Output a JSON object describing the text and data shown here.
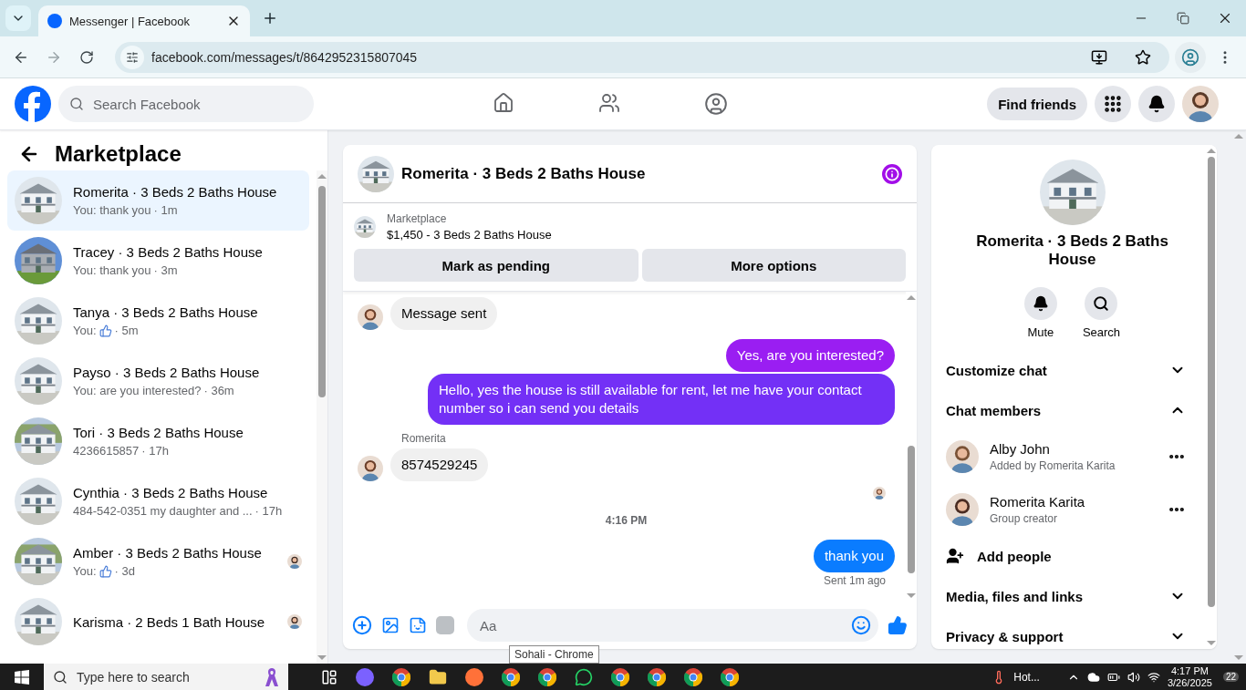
{
  "browser": {
    "tab_title": "Messenger | Facebook",
    "url": "facebook.com/messages/t/8642952315807045"
  },
  "header": {
    "search": {
      "placeholder": "Search Facebook"
    },
    "find_friends": "Find friends"
  },
  "sidebar": {
    "title": "Marketplace",
    "conversations": [
      {
        "name": "Romerita · 3 Beds 2 Baths House",
        "preview": "You: thank you",
        "like": false,
        "time": "· 1m",
        "seen": false,
        "selected": true
      },
      {
        "name": "Tracey · 3 Beds 2 Baths House",
        "preview": "You: thank you",
        "like": false,
        "time": "· 3m",
        "seen": false,
        "selected": false
      },
      {
        "name": "Tanya · 3 Beds 2 Baths House",
        "preview": "You:",
        "like": true,
        "time": "· 5m",
        "seen": false,
        "selected": false
      },
      {
        "name": "Payso · 3 Beds 2 Baths House",
        "preview": "You: are you interested?",
        "like": false,
        "time": "· 36m",
        "seen": false,
        "selected": false
      },
      {
        "name": "Tori · 3 Beds 2 Baths House",
        "preview": "4236615857",
        "like": false,
        "time": "· 17h",
        "seen": false,
        "selected": false
      },
      {
        "name": "Cynthia · 3 Beds 2 Baths House",
        "preview": "484-542-0351 my daughter and ...",
        "like": false,
        "time": "· 17h",
        "seen": false,
        "selected": false
      },
      {
        "name": "Amber · 3 Beds 2 Baths House",
        "preview": "You:",
        "like": true,
        "time": "· 3d",
        "seen": true,
        "selected": false
      },
      {
        "name": "Karisma · 2 Beds 1 Bath House",
        "seen": true,
        "selected": false
      }
    ]
  },
  "chat": {
    "title": "Romerita · 3 Beds 2 Baths House",
    "listing": {
      "label": "Marketplace",
      "title": "$1,450 - 3 Beds 2 Baths House"
    },
    "actions": [
      "Mark as pending",
      "More options"
    ],
    "messages": [
      {
        "kind": "incoming",
        "text": "Message sent"
      },
      {
        "kind": "outgoing",
        "text": "Yes, are you interested?",
        "color": "#9a1ef2"
      },
      {
        "kind": "outgoing",
        "text": "Hello, yes the house is still available for rent, let me have your contact number so i can send you  details",
        "color": "#7330f6"
      },
      {
        "kind": "incoming",
        "sender": "Romerita",
        "text": "8574529245"
      },
      {
        "kind": "seen"
      },
      {
        "kind": "timestamp",
        "text": "4:16 PM"
      },
      {
        "kind": "outgoing",
        "text": "thank you",
        "color": "#0a7cff",
        "status": "Sent 1m ago"
      }
    ],
    "composer": {
      "placeholder": "Aa"
    }
  },
  "info_panel": {
    "title": "Romerita · 3 Beds 2 Baths House",
    "actions": [
      "Mute",
      "Search"
    ],
    "sections": [
      {
        "title": "Customize chat",
        "expanded": false
      },
      {
        "title": "Chat members",
        "expanded": true,
        "members": [
          {
            "name": "Alby John",
            "role": "Added by Romerita Karita"
          },
          {
            "name": "Romerita Karita",
            "role": "Group creator"
          }
        ],
        "add": "Add people"
      },
      {
        "title": "Media, files and links",
        "expanded": false
      },
      {
        "title": "Privacy & support",
        "expanded": false
      }
    ]
  },
  "tooltip": "Sohali - Chrome",
  "taskbar": {
    "search": {
      "placeholder": "Type here to search"
    },
    "weather": "Hot...",
    "time": "4:17 PM",
    "date": "3/26/2025",
    "notifications": "22"
  }
}
